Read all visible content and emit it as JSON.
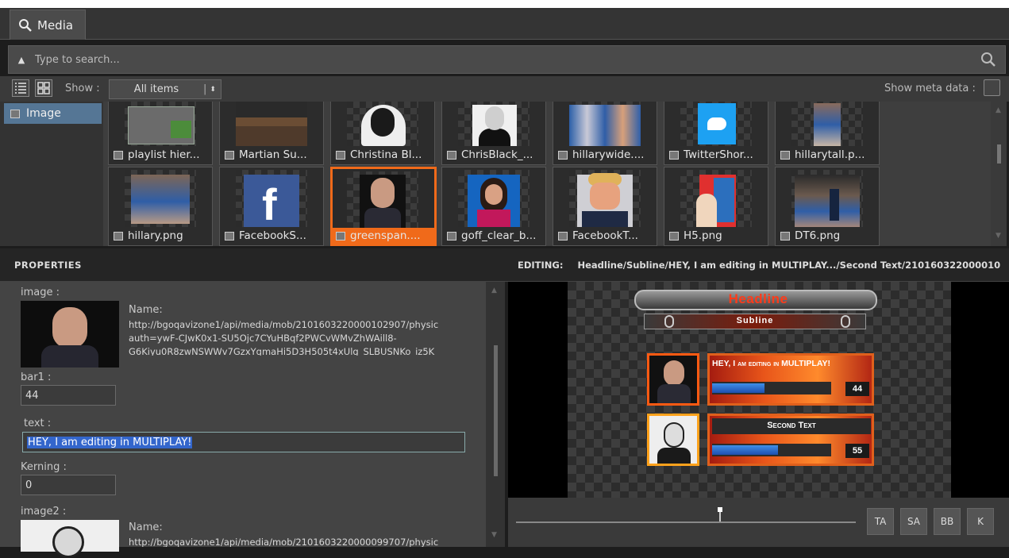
{
  "tab": {
    "label": "Media"
  },
  "search": {
    "placeholder": "Type to search..."
  },
  "toolbar": {
    "show_label": "Show :",
    "show_value": "All items",
    "meta_label": "Show meta data :"
  },
  "categories": [
    {
      "label": "Image"
    }
  ],
  "tiles": [
    {
      "label": "playlist hier..."
    },
    {
      "label": "Martian Su..."
    },
    {
      "label": "Christina Bl..."
    },
    {
      "label": "ChrisBlack_..."
    },
    {
      "label": "hillarywide...."
    },
    {
      "label": "TwitterShor..."
    },
    {
      "label": "hillarytall.p..."
    },
    {
      "label": "hillary.png"
    },
    {
      "label": "FacebookS..."
    },
    {
      "label": "greenspan...."
    },
    {
      "label": "goff_clear_b..."
    },
    {
      "label": "FacebookT..."
    },
    {
      "label": "H5.png"
    },
    {
      "label": "DT6.png"
    }
  ],
  "properties": {
    "header": "PROPERTIES",
    "image_label": "image :",
    "image_name_label": "Name:",
    "image_url_1": "http://bgoqavizone1/api/media/mob/2101603220000102907/physic",
    "image_url_2": "auth=ywF-CJwK0x1-SU5Ojc7CYuHBqf2PWCvWMvZhWAill8-",
    "image_url_3": "G6Kiyu0R8zwNSWWv7GzxYgmaHi5D3H505t4xUlg_SLBUSNKo_iz5K",
    "bar1_label": "bar1 :",
    "bar1_value": "44",
    "text_label": "text :",
    "text_value": "HEY, I am editing in MULTIPLAY!",
    "kerning_label": "Kerning :",
    "kerning_value": "0",
    "image2_label": "image2 :",
    "image2_name_label": "Name:",
    "image2_url_1": "http://bgoqavizone1/api/media/mob/2101603220000099707/physic"
  },
  "editing": {
    "label": "EDITING:",
    "path": "Headline/Subline/HEY, I am editing in MULTIPLAY.../Second Text/210160322000010"
  },
  "graphic": {
    "headline": "Headline",
    "subline": "Subline",
    "row1_text": "HEY, I am editing in MULTIPLAY!",
    "row1_value": "44",
    "row1_bar_fraction": 0.44,
    "row2_text": "Second Text",
    "row2_value": "55",
    "row2_bar_fraction": 0.55
  },
  "timeline_buttons": [
    "TA",
    "SA",
    "BB",
    "K"
  ],
  "colors": {
    "accent": "#f06a1a",
    "selection": "#557695"
  }
}
